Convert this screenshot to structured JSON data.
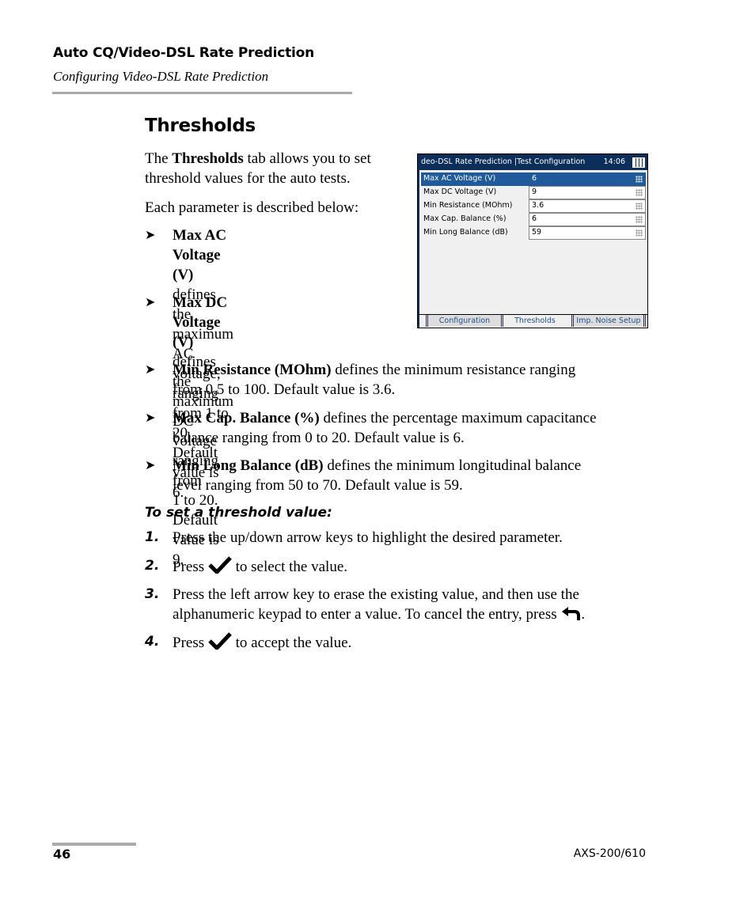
{
  "header": {
    "chapter": "Auto CQ/Video-DSL Rate Prediction",
    "section": "Configuring Video-DSL Rate Prediction"
  },
  "title": "Thresholds",
  "intro": {
    "pre": "The ",
    "bold": "Thresholds",
    "line1_rest": " tab allows you to set",
    "line2": "threshold values for the auto tests."
  },
  "each_param": "Each parameter is described below:",
  "bullets": [
    {
      "term": "Max AC Voltage (V)",
      "lines": [
        " defines the",
        "maximum AC voltage, ranging",
        "from 1 to 20. Default value is 6."
      ]
    },
    {
      "term": "Max DC Voltage (V)",
      "lines": [
        " defines the",
        "maximum DC voltage ranging from",
        "1 to 20. Default value is 9."
      ]
    },
    {
      "term": "Min Resistance (MOhm)",
      "lines": [
        " defines the minimum resistance ranging",
        "from 0.5 to 100. Default value is 3.6."
      ]
    },
    {
      "term": "Max Cap. Balance (%)",
      "lines": [
        " defines the percentage maximum capacitance",
        "balance ranging from 0 to 20. Default value is 6."
      ]
    },
    {
      "term": "Min Long Balance (dB)",
      "lines": [
        " defines the minimum longitudinal balance",
        "level ranging from 50 to 70. Default value is 59."
      ]
    }
  ],
  "procedure_title": "To set a threshold value:",
  "steps": [
    {
      "num": "1.",
      "text": "Press the up/down arrow keys to highlight the desired parameter."
    },
    {
      "num": "2.",
      "pre": "Press ",
      "post": " to select the value."
    },
    {
      "num": "3.",
      "line1": "Press the left arrow key to erase the existing value, and then use the",
      "line2": "alphanumeric keypad to enter a value. To cancel the entry, press ",
      "line2_end": "."
    },
    {
      "num": "4.",
      "pre": "Press ",
      "post": " to accept the value."
    }
  ],
  "device": {
    "title": "deo-DSL Rate Prediction |Test Configuration",
    "clock": "14:06",
    "rows": [
      {
        "label": "Max AC Voltage (V)",
        "value": "6",
        "selected": true
      },
      {
        "label": "Max DC Voltage (V)",
        "value": "9"
      },
      {
        "label": "Min Resistance (MOhm)",
        "value": "3.6"
      },
      {
        "label": "Max Cap. Balance (%)",
        "value": "6"
      },
      {
        "label": "Min Long Balance (dB)",
        "value": "59"
      }
    ],
    "tabs": [
      "Configuration",
      "Thresholds",
      "Imp. Noise Setup"
    ],
    "active_tab": "Thresholds"
  },
  "footer": {
    "page": "46",
    "product": "AXS-200/610"
  }
}
